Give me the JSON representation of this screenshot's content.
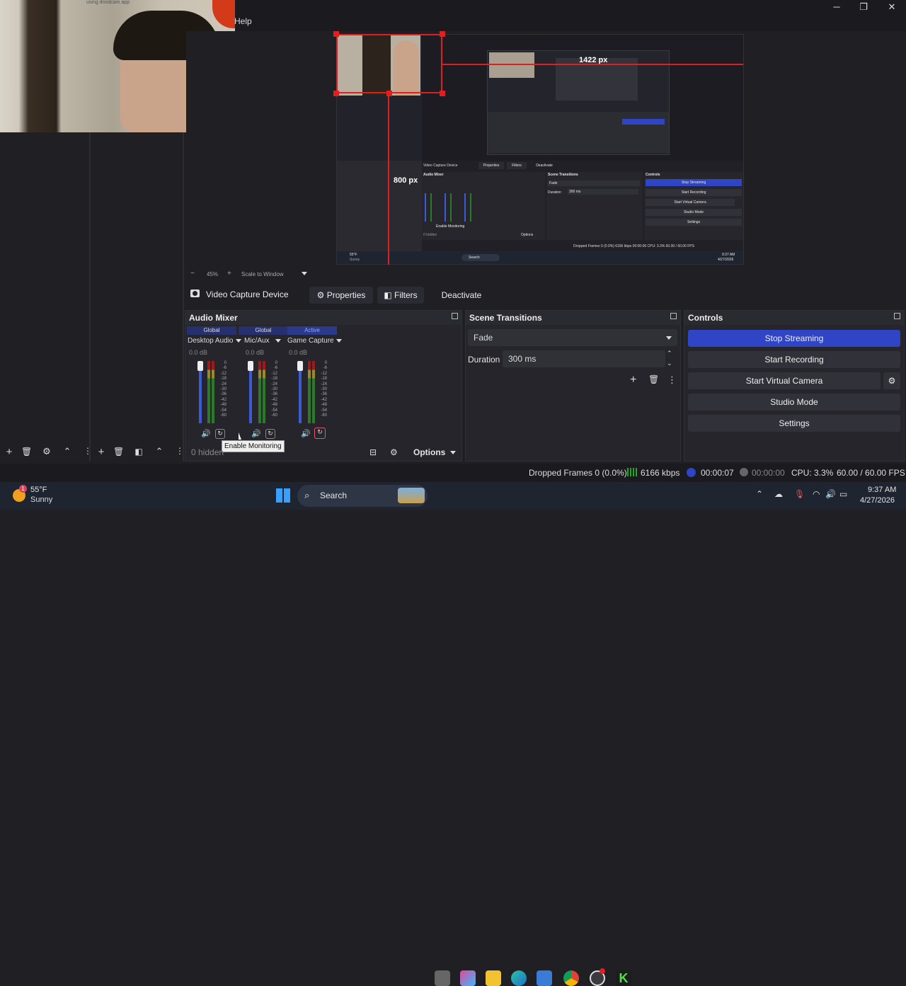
{
  "menu": {
    "help": "Help"
  },
  "camera": {
    "watermark": "using droidcam app"
  },
  "preview": {
    "inner_width_label": "1422 px",
    "inner_height_label": "800 px",
    "nested": {
      "source_label": "Video Capture Device",
      "properties": "Properties",
      "filters": "Filters",
      "deactivate": "Deactivate",
      "audio_mixer": "Audio Mixer",
      "scene_transitions": "Scene Transitions",
      "controls": "Controls",
      "fade": "Fade",
      "duration": "Duration",
      "duration_value": "300 ms",
      "stop_streaming": "Stop Streaming",
      "start_recording": "Start Recording",
      "start_virtual_camera": "Start Virtual Camera",
      "studio_mode": "Studio Mode",
      "settings": "Settings",
      "dropped_frames": "Dropped Frames 0 (0.0%)",
      "kbps": "6166 kbps",
      "stream_time": "00:00:06",
      "cpu": "CPU: 3.3%",
      "fps": "60.00 / 60.00 FPS",
      "hidden": "0 hidden",
      "options": "Options",
      "enable_monitoring": "Enable Monitoring",
      "search": "Search",
      "weather_temp": "55°F",
      "weather_desc": "Sunny",
      "time": "9:37 AM",
      "date": "4/27/2026"
    }
  },
  "zoombar": {
    "minus": "−",
    "zoom": "45%",
    "plus": "+",
    "scale_mode": "Scale to Window"
  },
  "source_toolbar": {
    "source_name": "Video Capture Device",
    "properties": "Properties",
    "filters": "Filters",
    "deactivate": "Deactivate"
  },
  "audio_mixer": {
    "title": "Audio Mixer",
    "channels": [
      {
        "tag": "Global",
        "name": "Desktop Audio",
        "db": "0.0 dB"
      },
      {
        "tag": "Global",
        "name": "Mic/Aux",
        "db": "0.0 dB"
      },
      {
        "tag": "Active",
        "name": "Game Capture",
        "db": "0.0 dB"
      }
    ],
    "scale": [
      "0",
      "-6",
      "-12",
      "-18",
      "-24",
      "-30",
      "-36",
      "-42",
      "-48",
      "-54",
      "-60"
    ],
    "tooltip": "Enable Monitoring",
    "hidden": "0 hidden",
    "options": "Options"
  },
  "scene_transitions": {
    "title": "Scene Transitions",
    "transition": "Fade",
    "duration_label": "Duration",
    "duration_value": "300 ms"
  },
  "controls": {
    "title": "Controls",
    "stop_streaming": "Stop Streaming",
    "start_recording": "Start Recording",
    "start_virtual_camera": "Start Virtual Camera",
    "studio_mode": "Studio Mode",
    "settings": "Settings"
  },
  "statusbar": {
    "dropped_frames": "Dropped Frames 0 (0.0%)",
    "bitrate": "6166 kbps",
    "stream_time": "00:00:07",
    "record_time": "00:00:00",
    "cpu": "CPU: 3.3%",
    "fps": "60.00 / 60.00 FPS"
  },
  "taskbar": {
    "weather_badge": "1",
    "weather_temp": "55°F",
    "weather_desc": "Sunny",
    "search": "Search",
    "time": "9:37 AM",
    "date": "4/27/2026"
  },
  "colors": {
    "accent_blue": "#2f45c5",
    "selection_red": "#e02020",
    "meter_green": "#2a7a2a"
  }
}
